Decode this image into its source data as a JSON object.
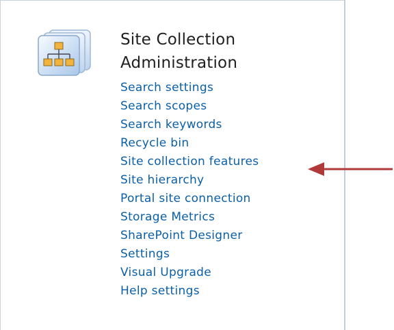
{
  "section": {
    "title_line1": "Site Collection",
    "title_line2": "Administration",
    "icon": "site-hierarchy-icon"
  },
  "links": [
    {
      "label": "Search settings"
    },
    {
      "label": "Search scopes"
    },
    {
      "label": "Search keywords"
    },
    {
      "label": "Recycle bin"
    },
    {
      "label": "Site collection features"
    },
    {
      "label": "Site hierarchy"
    },
    {
      "label": "Portal site connection"
    },
    {
      "label": "Storage Metrics"
    },
    {
      "label": "SharePoint Designer"
    },
    {
      "label": "Settings"
    },
    {
      "label": "Visual Upgrade"
    },
    {
      "label": "Help settings"
    }
  ],
  "annotation": {
    "icon": "pointer-arrow-icon",
    "color": "#b03a3a"
  },
  "colors": {
    "link": "#0a5fa8",
    "title": "#1f1f1f",
    "border": "#c9d3de"
  }
}
